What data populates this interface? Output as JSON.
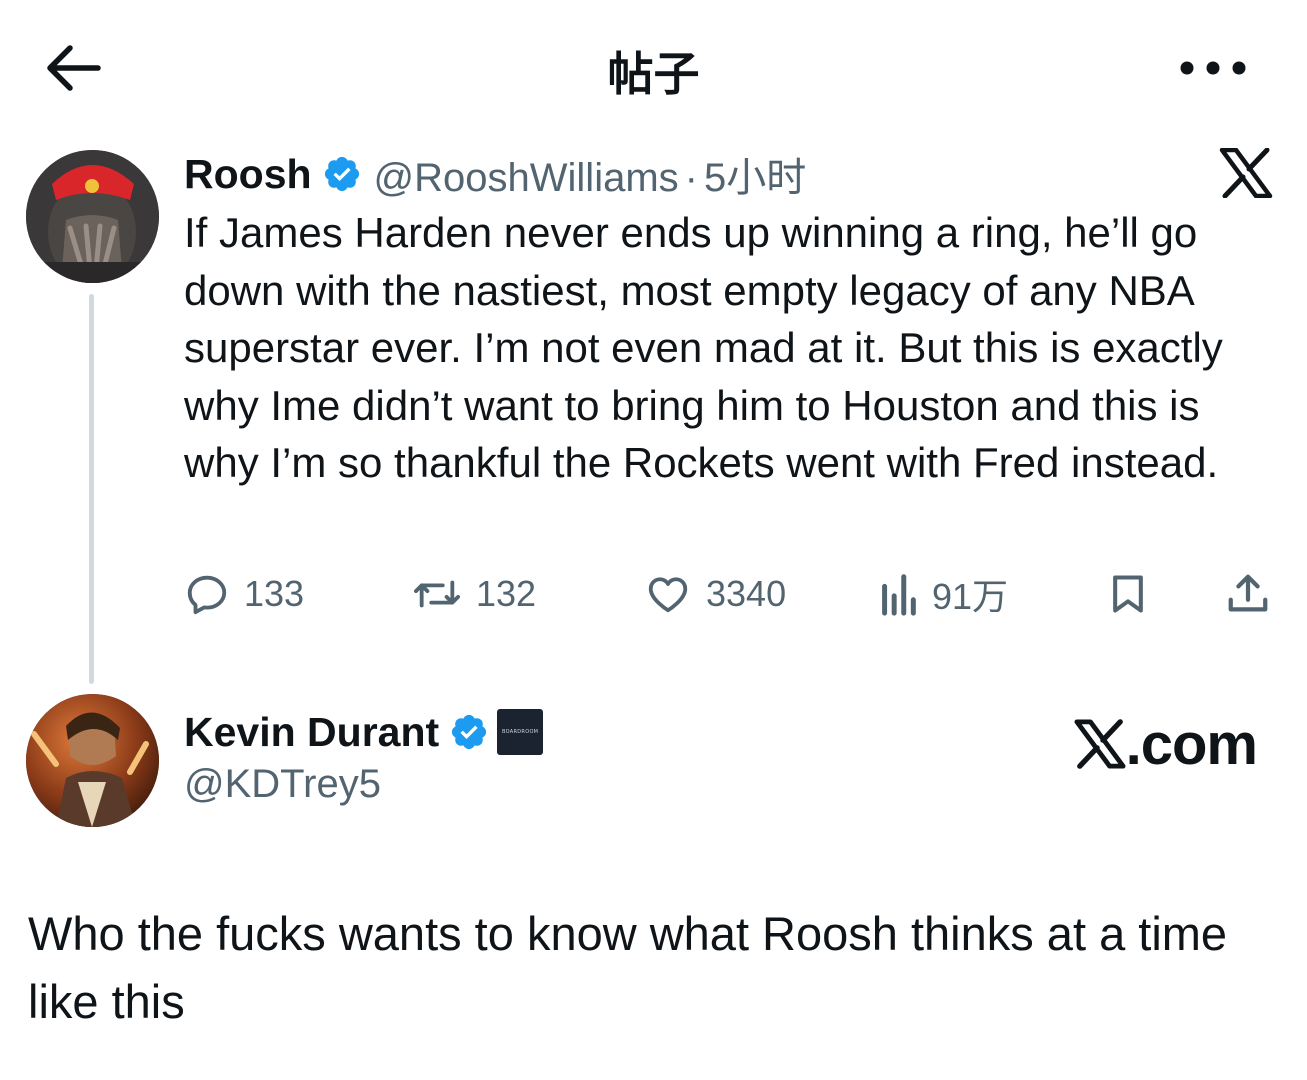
{
  "header": {
    "title": "帖子",
    "back_icon": "arrow-left-icon",
    "more_icon": "more-horizontal-icon"
  },
  "tweet": {
    "display_name": "Roosh",
    "handle": "@RooshWilliams",
    "separator": "·",
    "timestamp": "5小时",
    "text": "If James Harden never ends up winning a ring, he’ll go down with the nastiest, most empty legacy of any NBA superstar ever. I’m not even mad at it. But this is exactly why Ime didn’t want to bring him to Houston and this is why I’m so thankful the Rockets went with Fred instead.",
    "actions": {
      "replies": "133",
      "reposts": "132",
      "likes": "3340",
      "views": "91万"
    }
  },
  "reply": {
    "display_name": "Kevin Durant",
    "handle": "@KDTrey5",
    "affiliate_label": "BOARDROOM",
    "watermark_text": ".com",
    "text": "Who the fucks wants to know what Roosh thinks at a time like this"
  },
  "colors": {
    "text_primary": "#0f1419",
    "text_secondary": "#536471",
    "verified_blue": "#1d9bf0",
    "thread_line": "#cfd9de"
  }
}
